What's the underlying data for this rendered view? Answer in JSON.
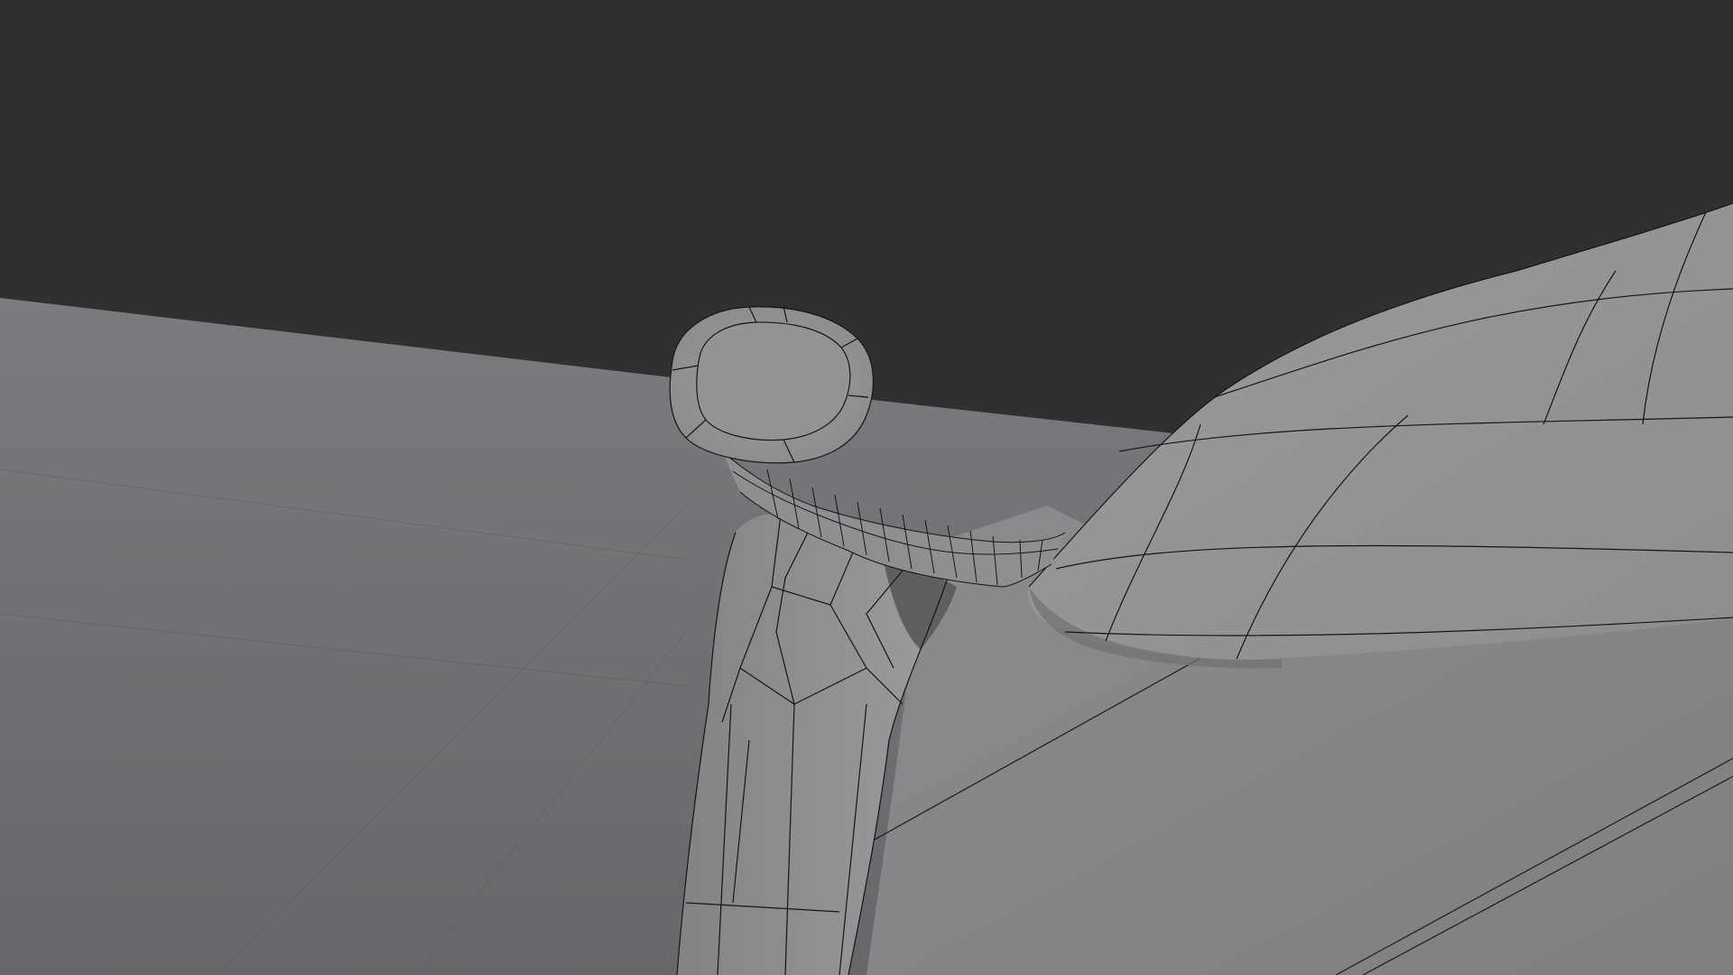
{
  "viewport": {
    "background_color": "#303030",
    "ground_color": "#6c6d70",
    "shading": "solid",
    "wireframe_overlay": true,
    "wire_color": "#151515",
    "mesh_color": "#8e8f91"
  },
  "objects": [
    {
      "name": "ground-plane"
    },
    {
      "name": "mirror-head"
    },
    {
      "name": "mirror-arm"
    },
    {
      "name": "a-pillar"
    },
    {
      "name": "window-surface"
    },
    {
      "name": "door-panel"
    }
  ]
}
